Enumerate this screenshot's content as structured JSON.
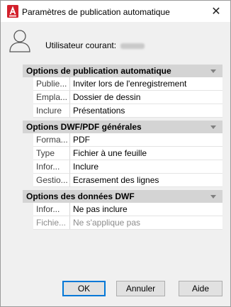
{
  "window": {
    "title": "Paramètres de publication automatique",
    "close_glyph": "✕",
    "app_icon": "autocad-a-icon"
  },
  "user": {
    "label": "Utilisateur courant:",
    "icon": "user-icon"
  },
  "sections": [
    {
      "title": "Options de publication automatique",
      "rows": [
        {
          "key": "Publie...",
          "value": "Inviter lors de l'enregistrement",
          "disabled": false
        },
        {
          "key": "Empla...",
          "value": "Dossier de dessin",
          "disabled": false
        },
        {
          "key": "Inclure",
          "value": "Présentations",
          "disabled": false
        }
      ]
    },
    {
      "title": "Options DWF/PDF générales",
      "rows": [
        {
          "key": "Forma...",
          "value": "PDF",
          "disabled": false
        },
        {
          "key": "Type",
          "value": "Fichier à une feuille",
          "disabled": false
        },
        {
          "key": "Infor...",
          "value": "Inclure",
          "disabled": false
        },
        {
          "key": "Gestio...",
          "value": "Ecrasement des lignes",
          "disabled": false
        }
      ]
    },
    {
      "title": "Options des données DWF",
      "rows": [
        {
          "key": "Infor...",
          "value": "Ne pas inclure",
          "disabled": false
        },
        {
          "key": "Fichie...",
          "value": "Ne s'applique pas",
          "disabled": true
        }
      ]
    }
  ],
  "buttons": {
    "ok": "OK",
    "cancel": "Annuler",
    "help": "Aide"
  },
  "colors": {
    "accent": "#0078d7",
    "app_icon_red": "#d3212c",
    "section_header_bg": "#d4d4d4"
  }
}
